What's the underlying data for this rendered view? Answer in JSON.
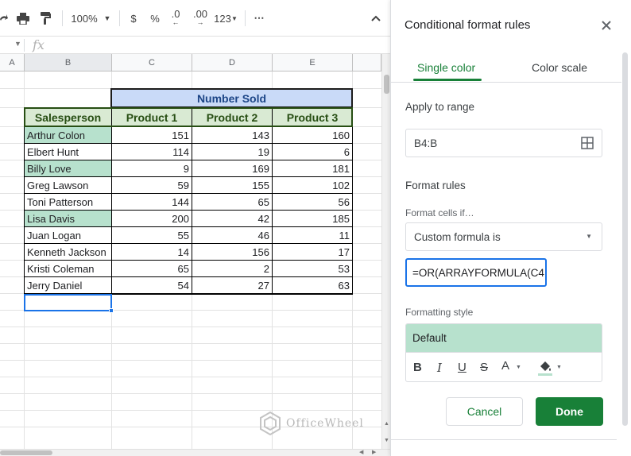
{
  "toolbar": {
    "zoom": "100%",
    "currency": "$",
    "percent": "%",
    "dec_decrease": ".0",
    "dec_increase": ".00",
    "more_formats": "123",
    "more": "⋯"
  },
  "formula_bar": {
    "fx": "fx"
  },
  "columns": [
    "A",
    "B",
    "C",
    "D",
    "E"
  ],
  "table": {
    "group_header": "Number Sold",
    "headers": [
      "Salesperson",
      "Product 1",
      "Product 2",
      "Product 3"
    ],
    "rows": [
      [
        "Arthur Colon",
        "151",
        "143",
        "160"
      ],
      [
        "Elbert Hunt",
        "114",
        "19",
        "6"
      ],
      [
        "Billy Love",
        "9",
        "169",
        "181"
      ],
      [
        "Greg Lawson",
        "59",
        "155",
        "102"
      ],
      [
        "Toni Patterson",
        "144",
        "65",
        "56"
      ],
      [
        "Lisa Davis",
        "200",
        "42",
        "185"
      ],
      [
        "Juan Logan",
        "55",
        "46",
        "11"
      ],
      [
        "Kenneth Jackson",
        "14",
        "156",
        "17"
      ],
      [
        "Kristi Coleman",
        "65",
        "2",
        "53"
      ],
      [
        "Jerry Daniel",
        "54",
        "27",
        "63"
      ]
    ],
    "highlighted_rows": [
      0,
      2,
      5
    ],
    "highlight_color": "#b7e1cd",
    "header_fill": "#d9ead3",
    "group_header_fill": "#c9daf8"
  },
  "panel": {
    "title": "Conditional format rules",
    "close": "✕",
    "tab_single": "Single color",
    "tab_scale": "Color scale",
    "apply_label": "Apply to range",
    "range": "B4:B",
    "rules_label": "Format rules",
    "condition_label": "Format cells if…",
    "condition": "Custom formula is",
    "formula": "=OR(ARRAYFORMULA(C4",
    "style_label": "Formatting style",
    "style_default": "Default",
    "fmt_bold": "B",
    "fmt_italic": "I",
    "fmt_underline": "U",
    "fmt_strike": "S",
    "fmt_text_color": "A",
    "cancel": "Cancel",
    "done": "Done",
    "accent_color": "#188038"
  },
  "watermark": "OfficeWheel"
}
